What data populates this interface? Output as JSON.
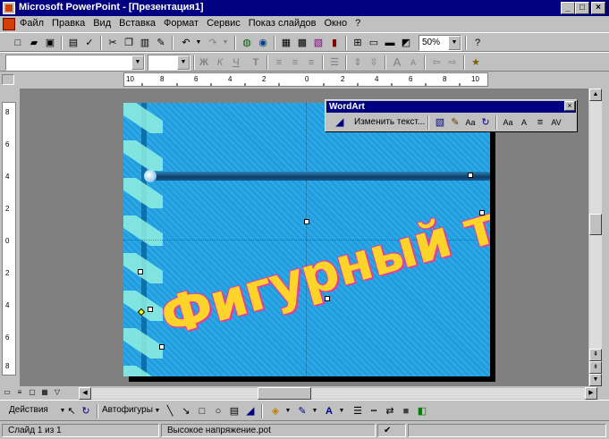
{
  "window": {
    "title": "Microsoft PowerPoint - [Презентация1]",
    "minimize": "_",
    "maximize": "□",
    "close": "×"
  },
  "menu": {
    "items": [
      "Файл",
      "Правка",
      "Вид",
      "Вставка",
      "Формат",
      "Сервис",
      "Показ слайдов",
      "Окно",
      "?"
    ]
  },
  "standard_toolbar": {
    "zoom": "50%",
    "icons": [
      "new-icon",
      "open-icon",
      "save-icon",
      "print-icon",
      "spelling-icon",
      "cut-icon",
      "copy-icon",
      "paste-icon",
      "format-painter-icon",
      "undo-icon",
      "redo-icon",
      "hyperlink-icon",
      "web-toolbar-icon",
      "insert-table-icon",
      "insert-word-table-icon",
      "insert-chart-icon",
      "new-slide-icon",
      "slide-layout-icon",
      "apply-design-icon",
      "grayscale-icon",
      "help-icon"
    ]
  },
  "formatting_toolbar": {
    "font_name": "",
    "font_size": "",
    "bold": "Ж",
    "italic": "К",
    "underline": "Ч",
    "shadow": "Т",
    "increase_font": "A",
    "decrease_font": "A"
  },
  "rulers": {
    "horizontal": [
      "10",
      "8",
      "6",
      "4",
      "2",
      "0",
      "2",
      "4",
      "6",
      "8",
      "10"
    ],
    "vertical": [
      "8",
      "6",
      "4",
      "2",
      "0",
      "2",
      "4",
      "6",
      "8"
    ]
  },
  "slide": {
    "wordart_text": "Фигурный текст"
  },
  "wordart_toolbar": {
    "title": "WordArt",
    "edit_text": "Изменить текст...",
    "close": "×",
    "same_height": "Aa",
    "vertical_text": "A",
    "char_spacing": "AV"
  },
  "drawing_toolbar": {
    "actions_label": "Действия",
    "autoshapes_label": "Автофигуры"
  },
  "status": {
    "slide": "Слайд 1 из 1",
    "design": "Высокое напряжение.pot"
  },
  "colors": {
    "titlebar": "#000080",
    "slide_background": "#1e9ee0",
    "wordart_fill": "#ffd42a",
    "wordart_outline": "#e040a0"
  }
}
